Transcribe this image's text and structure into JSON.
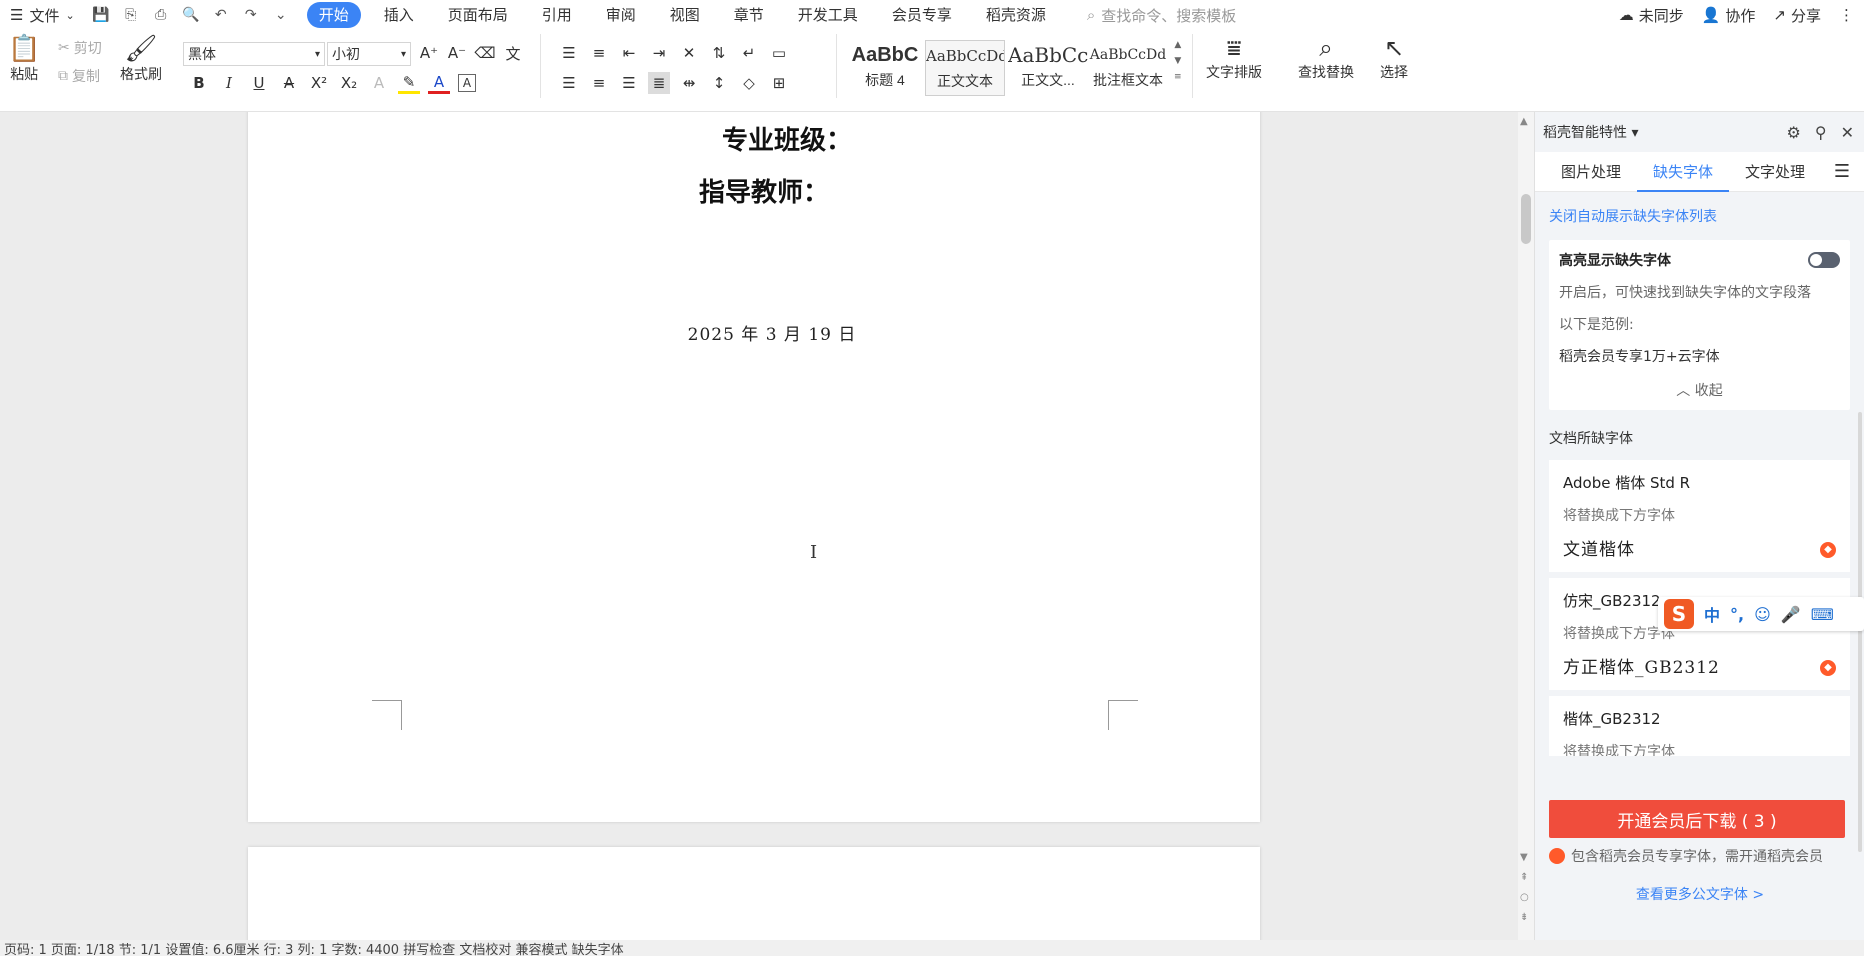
{
  "menu": {
    "file_label": "文件",
    "tabs": [
      "开始",
      "插入",
      "页面布局",
      "引用",
      "审阅",
      "视图",
      "章节",
      "开发工具",
      "会员专享",
      "稻壳资源"
    ],
    "search_placeholder": "查找命令、搜索模板",
    "sync": "未同步",
    "collab": "协作",
    "share": "分享"
  },
  "ribbon": {
    "paste": "粘贴",
    "cut": "剪切",
    "copy": "复制",
    "format_painter": "格式刷",
    "font_name": "黑体",
    "font_size": "小初",
    "styles": [
      {
        "preview": "AaBbC",
        "label": "标题 4"
      },
      {
        "preview": "AaBbCcDd",
        "label": "正文文本"
      },
      {
        "preview": "AaBbCc",
        "label": "正文文..."
      },
      {
        "preview": "AaBbCcDd",
        "label": "批注框文本"
      }
    ],
    "text_layout": "文字排版",
    "find_replace": "查找替换",
    "select": "选择"
  },
  "document": {
    "line1": "专业班级：",
    "line2": "指导教师：",
    "date": "2025 年 3 月 19 日"
  },
  "panel": {
    "title": "稻壳智能特性",
    "tabs": [
      "图片处理",
      "缺失字体",
      "文字处理"
    ],
    "link": "关闭自动展示缺失字体列表",
    "highlight_title": "高亮显示缺失字体",
    "highlight_desc": "开启后，可快速找到缺失字体的文字段落",
    "example_intro": "以下是范例:",
    "example": "稻壳会员专享1万+云字体",
    "collapse": "收起",
    "missing_title": "文档所缺字体",
    "fonts": [
      {
        "name": "Adobe 楷体 Std R",
        "sub": "将替换成下方字体",
        "replace": "文道楷体"
      },
      {
        "name": "仿宋_GB2312",
        "sub": "将替换成下方字体",
        "replace": "方正楷体_GB2312"
      },
      {
        "name": "楷体_GB2312",
        "sub": "将替换成下方字体",
        "replace": ""
      }
    ],
    "cta": "开通会员后下载 ( 3 )",
    "note": "包含稻壳会员专享字体，需开通稻壳会员",
    "more": "查看更多公文字体 >"
  },
  "ime": {
    "lang": "中",
    "punct": "°,"
  },
  "status": {
    "text": "页码: 1  页面: 1/18  节: 1/1  设置值: 6.6厘米  行: 3  列: 1  字数: 4400  拼写检查  文档校对  兼容模式  缺失字体"
  }
}
